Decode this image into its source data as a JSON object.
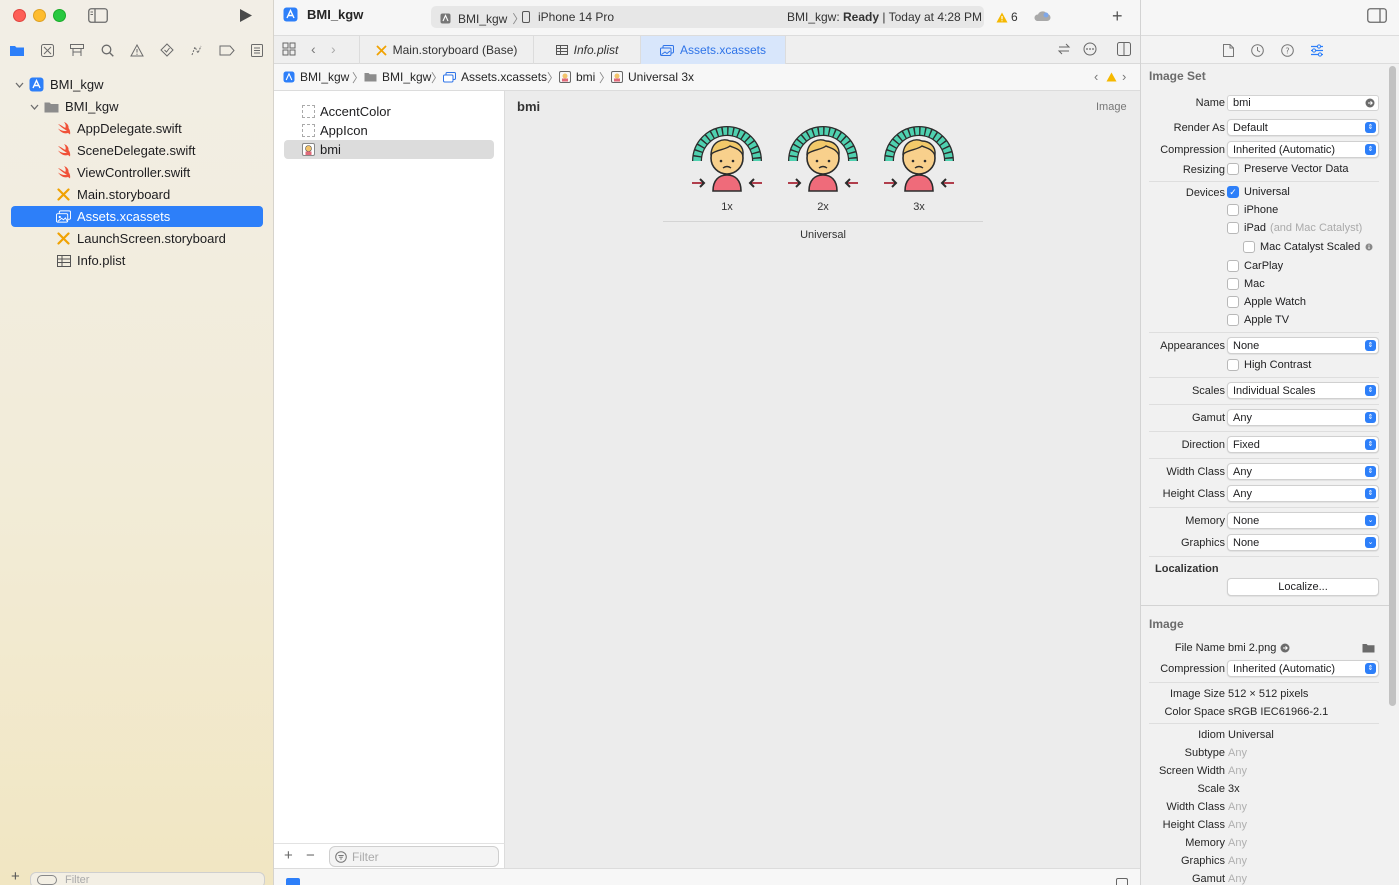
{
  "toolbar": {
    "project_name": "BMI_kgw",
    "scheme": "BMI_kgw",
    "device": "iPhone 14 Pro",
    "status_prefix": "BMI_kgw: ",
    "status_state": "Ready",
    "status_time": "| Today at 4:28 PM",
    "warning_count": "6"
  },
  "navigator": {
    "items": [
      {
        "label": "BMI_kgw"
      },
      {
        "label": "BMI_kgw"
      },
      {
        "label": "AppDelegate.swift"
      },
      {
        "label": "SceneDelegate.swift"
      },
      {
        "label": "ViewController.swift"
      },
      {
        "label": "Main.storyboard"
      },
      {
        "label": "Assets.xcassets"
      },
      {
        "label": "LaunchScreen.storyboard"
      },
      {
        "label": "Info.plist"
      }
    ],
    "filter_placeholder": "Filter"
  },
  "tabs": [
    {
      "label": "Main.storyboard (Base)"
    },
    {
      "label": "Info.plist"
    },
    {
      "label": "Assets.xcassets"
    }
  ],
  "breadcrumb": [
    "BMI_kgw",
    "BMI_kgw",
    "Assets.xcassets",
    "bmi",
    "Universal 3x"
  ],
  "assets": {
    "items": [
      {
        "label": "AccentColor"
      },
      {
        "label": "AppIcon"
      },
      {
        "label": "bmi"
      }
    ],
    "filter_placeholder": "Filter"
  },
  "canvas": {
    "title": "bmi",
    "type_label": "Image",
    "slots": [
      {
        "label": "1x"
      },
      {
        "label": "2x"
      },
      {
        "label": "3x"
      }
    ],
    "group_label": "Universal"
  },
  "inspector": {
    "image_set": {
      "section": "Image Set",
      "name_label": "Name",
      "name_value": "bmi",
      "render_as_label": "Render As",
      "render_as_value": "Default",
      "compression_label": "Compression",
      "compression_value": "Inherited (Automatic)",
      "resizing_label": "Resizing",
      "preserve_vector": "Preserve Vector Data",
      "devices_label": "Devices",
      "devices": {
        "universal": "Universal",
        "iphone": "iPhone",
        "ipad": "iPad",
        "ipad_note": "(and Mac Catalyst)",
        "mac_catalyst_scaled": "Mac Catalyst Scaled",
        "carplay": "CarPlay",
        "mac": "Mac",
        "apple_watch": "Apple Watch",
        "apple_tv": "Apple TV"
      },
      "appearances_label": "Appearances",
      "appearances_value": "None",
      "high_contrast": "High Contrast",
      "scales_label": "Scales",
      "scales_value": "Individual Scales",
      "gamut_label": "Gamut",
      "gamut_value": "Any",
      "direction_label": "Direction",
      "direction_value": "Fixed",
      "width_class_label": "Width Class",
      "width_class_value": "Any",
      "height_class_label": "Height Class",
      "height_class_value": "Any",
      "memory_label": "Memory",
      "memory_value": "None",
      "graphics_label": "Graphics",
      "graphics_value": "None",
      "localization_section": "Localization",
      "localize_button": "Localize..."
    },
    "image": {
      "section": "Image",
      "file_name_label": "File Name",
      "file_name_value": "bmi 2.png",
      "compression_label": "Compression",
      "compression_value": "Inherited (Automatic)",
      "image_size_label": "Image Size",
      "image_size_value": "512 × 512 pixels",
      "color_space_label": "Color Space",
      "color_space_value": "sRGB IEC61966-2.1",
      "idiom_label": "Idiom",
      "idiom_value": "Universal",
      "subtype_label": "Subtype",
      "subtype_value": "Any",
      "screen_width_label": "Screen Width",
      "screen_width_value": "Any",
      "scale_label": "Scale",
      "scale_value": "3x",
      "width_class_label": "Width Class",
      "width_class_value": "Any",
      "height_class_label": "Height Class",
      "height_class_value": "Any",
      "memory_label": "Memory",
      "memory_value": "Any",
      "graphics_label": "Graphics",
      "graphics_value": "Any",
      "gamut_label": "Gamut",
      "gamut_value": "Any"
    }
  },
  "colors": {
    "accent": "#2d7ff9",
    "warning": "#f5b800",
    "swift": "#f05138"
  }
}
